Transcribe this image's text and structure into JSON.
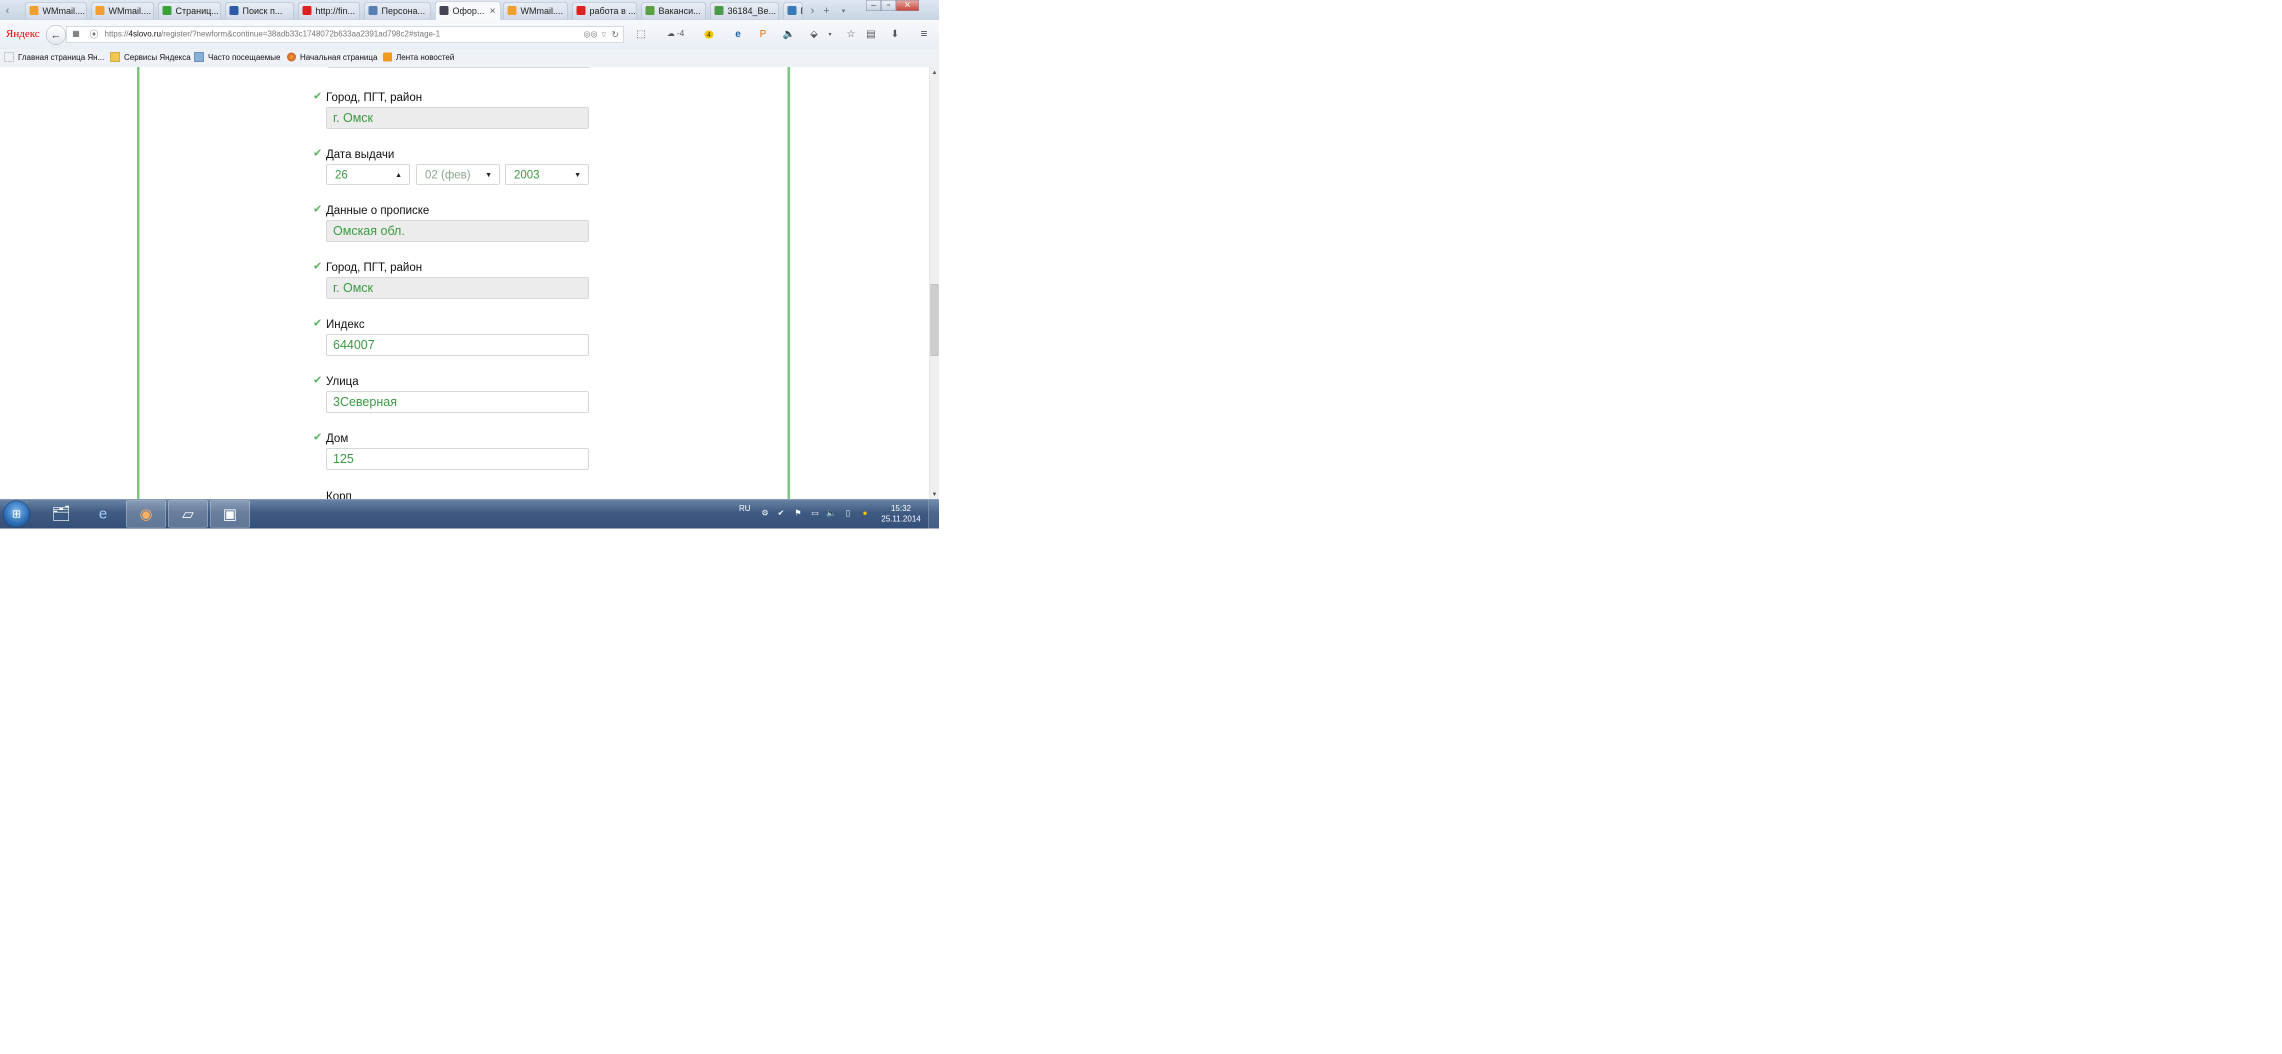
{
  "tabs": [
    {
      "label": "WMmail....",
      "icon": "wmmail-icon",
      "color": "#f0a030"
    },
    {
      "label": "WMmail....",
      "icon": "wmmail-icon",
      "color": "#f0a030"
    },
    {
      "label": "Страниц...",
      "icon": "k-icon",
      "color": "#3aa03a"
    },
    {
      "label": "Поиск п...",
      "icon": "k-icon",
      "color": "#2b5aa8"
    },
    {
      "label": "http://fin...",
      "icon": "yandex-icon",
      "color": "#e02020"
    },
    {
      "label": "Персона...",
      "icon": "globe-icon",
      "color": "#5a7fb5"
    },
    {
      "label": "Офор...",
      "icon": "site-icon",
      "color": "#445"
    },
    {
      "label": "WMmail....",
      "icon": "wmmail-icon",
      "color": "#f0a030"
    },
    {
      "label": "работа в ...",
      "icon": "yandex-icon",
      "color": "#e02020"
    },
    {
      "label": "Ваканси...",
      "icon": "hh-icon",
      "color": "#5aa040"
    },
    {
      "label": "36184_Ве...",
      "icon": "image-icon",
      "color": "#4a9a4a"
    },
    {
      "label": "П",
      "icon": "site-icon",
      "color": "#3a7ab8"
    }
  ],
  "navbar": {
    "logo": "Яндекс",
    "url_prefix": "https://",
    "url_domain": "4slovo.ru",
    "url_path": "/register/?newform&continue=38adb33c1748072b633aa2391ad798c2#stage-1",
    "weather": "-4",
    "badge": "4"
  },
  "bookmarks": [
    {
      "label": "Главная страница Ян...",
      "icon": "page-icon"
    },
    {
      "label": "Сервисы Яндекса",
      "icon": "folder-icon"
    },
    {
      "label": "Часто посещаемые",
      "icon": "history-icon"
    },
    {
      "label": "Начальная страница",
      "icon": "firefox-icon"
    },
    {
      "label": "Лента новостей",
      "icon": "rss-icon"
    }
  ],
  "form": {
    "city1": {
      "label": "Город, ПГТ, район",
      "value": "г. Омск"
    },
    "issue_date": {
      "label": "Дата выдачи",
      "day": "26",
      "month": "02 (фев)",
      "year": "2003"
    },
    "registration": {
      "label": "Данные о прописке",
      "value": "Омская обл."
    },
    "city2": {
      "label": "Город, ПГТ, район",
      "value": "г. Омск"
    },
    "index": {
      "label": "Индекс",
      "value": "644007"
    },
    "street": {
      "label": "Улица",
      "value": "3Северная"
    },
    "house": {
      "label": "Дом",
      "value": "125"
    },
    "corp": {
      "label": "Корп"
    }
  },
  "taskbar": {
    "lang": "RU",
    "time": "15:32",
    "date": "25.11.2014"
  },
  "colors": {
    "accent_green": "#7cc47f",
    "value_green": "#3a9a42"
  }
}
